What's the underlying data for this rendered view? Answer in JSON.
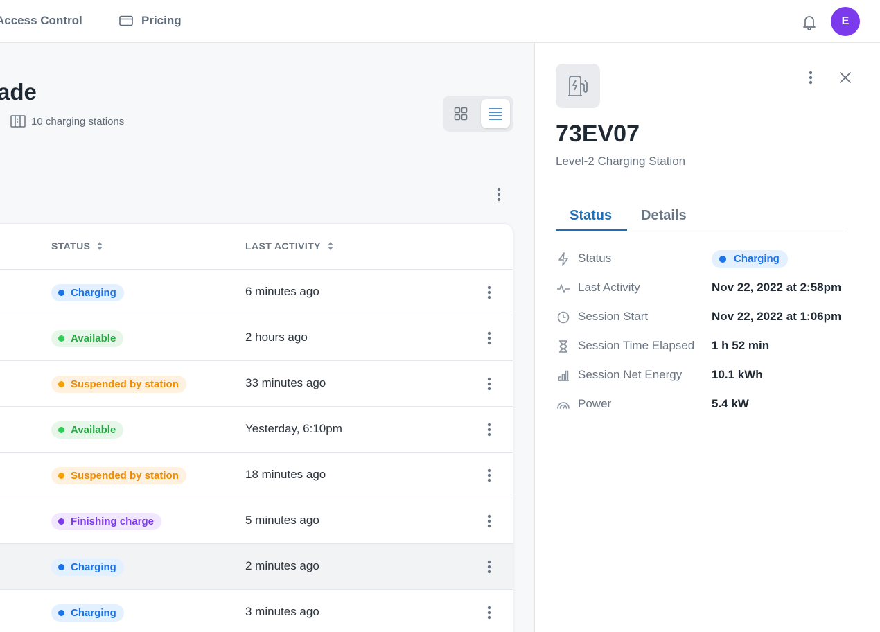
{
  "nav": {
    "access_label": "Access Control",
    "pricing_label": "Pricing",
    "avatar_initial": "E"
  },
  "colors": {
    "accent": "#1d6fb8",
    "avatar": "#7c3aed",
    "charging_text": "#1a73e8",
    "charging_bg": "#e3f0ff",
    "charging_dot": "#1a73e8",
    "available_text": "#28a745",
    "available_bg": "#e6f7ea",
    "available_dot": "#2ecc55",
    "suspended_text": "#f08c00",
    "suspended_bg": "#fff1e0",
    "suspended_dot": "#f59f00",
    "finishing_text": "#7c3aed",
    "finishing_bg": "#f1e8ff",
    "finishing_dot": "#7c3aed"
  },
  "page": {
    "title": "ade",
    "station_count": "10 charging stations"
  },
  "table": {
    "col_status": "STATUS",
    "col_activity": "LAST ACTIVITY",
    "rows": [
      {
        "status": "Charging",
        "kind": "charging",
        "activity": "6 minutes ago"
      },
      {
        "status": "Available",
        "kind": "available",
        "activity": "2 hours ago"
      },
      {
        "status": "Suspended by station",
        "kind": "suspended",
        "activity": "33 minutes ago"
      },
      {
        "status": "Available",
        "kind": "available",
        "activity": "Yesterday, 6:10pm"
      },
      {
        "status": "Suspended by station",
        "kind": "suspended",
        "activity": "18 minutes ago"
      },
      {
        "status": "Finishing charge",
        "kind": "finishing",
        "activity": "5 minutes ago"
      },
      {
        "status": "Charging",
        "kind": "charging",
        "activity": "2 minutes ago"
      },
      {
        "status": "Charging",
        "kind": "charging",
        "activity": "3 minutes ago"
      }
    ]
  },
  "panel": {
    "station_id": "73EV07",
    "station_type": "Level-2 Charging Station",
    "tabs": [
      {
        "label": "Status"
      },
      {
        "label": "Details"
      }
    ],
    "fields": [
      {
        "label": "Status",
        "value": "Charging",
        "icon": "lightning-icon"
      },
      {
        "label": "Last Activity",
        "value": "Nov 22, 2022 at 2:58pm",
        "icon": "activity-icon"
      },
      {
        "label": "Session Start",
        "value": "Nov 22, 2022 at 1:06pm",
        "icon": "clock-icon"
      },
      {
        "label": "Session Time Elapsed",
        "value": "1 h 52 min",
        "icon": "hourglass-icon"
      },
      {
        "label": "Session Net Energy",
        "value": "10.1 kWh",
        "icon": "energy-chart-icon"
      },
      {
        "label": "Power",
        "value": "5.4 kW",
        "icon": "gauge-icon"
      }
    ]
  }
}
